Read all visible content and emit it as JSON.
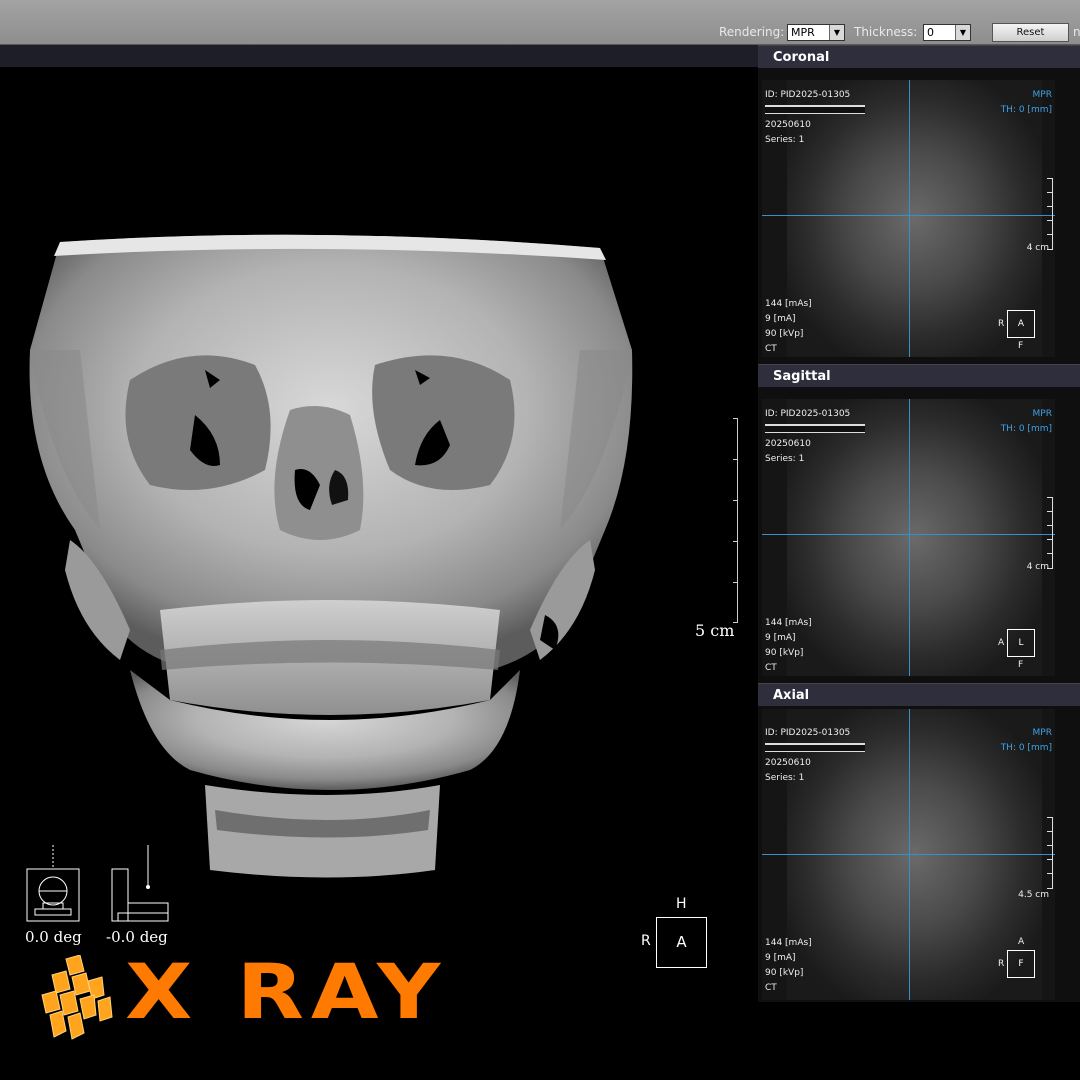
{
  "toolbar": {
    "rendering_label": "Rendering:",
    "rendering_value": "MPR",
    "thickness_label": "Thickness:",
    "thickness_value": "0",
    "reset_label": "Reset",
    "cut_label": "n"
  },
  "main_view": {
    "scale_label": "5 cm",
    "orientation": {
      "top": "H",
      "left": "R",
      "center": "A"
    },
    "rotation_1": "0.0 deg",
    "rotation_2": "-0.0 deg"
  },
  "logo": {
    "text": "X RAY",
    "color": "#ff7a00"
  },
  "panels": [
    {
      "title": "Coronal",
      "id": "ID: PID2025-01305",
      "date": "20250610",
      "series": "Series: 1",
      "mode": "MPR",
      "thickness": "TH: 0 [mm]",
      "mas": "144 [mAs]",
      "ma": "9 [mA]",
      "kvp": "90 [kVp]",
      "modality": "CT",
      "scale": "4 cm",
      "orient_left": "R",
      "orient_box": "A",
      "orient_bottom": "F",
      "orient_top": ""
    },
    {
      "title": "Sagittal",
      "id": "ID: PID2025-01305",
      "date": "20250610",
      "series": "Series: 1",
      "mode": "MPR",
      "thickness": "TH: 0 [mm]",
      "mas": "144 [mAs]",
      "ma": "9 [mA]",
      "kvp": "90 [kVp]",
      "modality": "CT",
      "scale": "4 cm",
      "orient_left": "A",
      "orient_box": "L",
      "orient_bottom": "F",
      "orient_top": ""
    },
    {
      "title": "Axial",
      "id": "ID: PID2025-01305",
      "date": "20250610",
      "series": "Series: 1",
      "mode": "MPR",
      "thickness": "TH: 0 [mm]",
      "mas": "144 [mAs]",
      "ma": "9 [mA]",
      "kvp": "90 [kVp]",
      "modality": "CT",
      "scale": "4.5 cm",
      "orient_left": "R",
      "orient_box": "F",
      "orient_bottom": "",
      "orient_top": "A"
    }
  ],
  "colors": {
    "crosshair": "#3a8fc8",
    "overlay_blue": "#3fa0e6",
    "panel_header": "#2e2e3c"
  }
}
